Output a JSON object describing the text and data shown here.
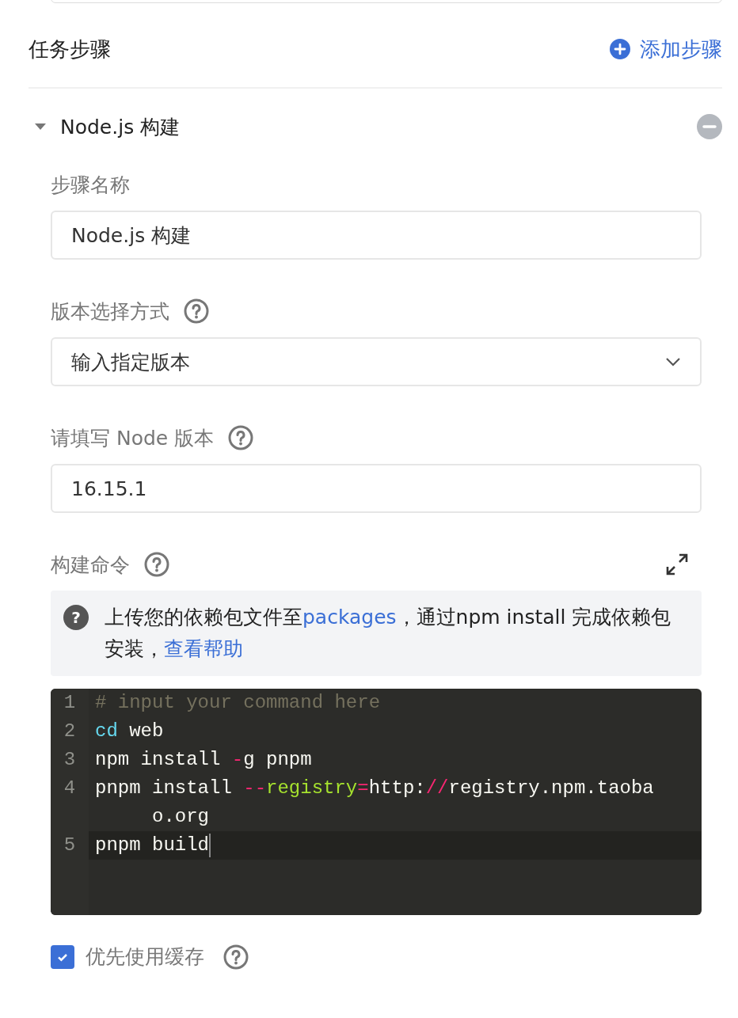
{
  "section": {
    "title": "任务步骤",
    "add_button": "添加步骤"
  },
  "step": {
    "title": "Node.js 构建",
    "expanded": true,
    "fields": [
      {
        "kind": "text",
        "label": "步骤名称",
        "help": false,
        "value": "Node.js 构建"
      },
      {
        "kind": "select",
        "label": "版本选择方式",
        "help": true,
        "value": "输入指定版本"
      },
      {
        "kind": "text",
        "label": "请填写 Node 版本",
        "help": true,
        "value": "16.15.1"
      }
    ],
    "command": {
      "label": "构建命令",
      "help": true,
      "notice": {
        "icon": "?",
        "parts": [
          {
            "kind": "text",
            "text": "上传您的依赖包文件至"
          },
          {
            "kind": "link",
            "text": "packages"
          },
          {
            "kind": "text",
            "text": "，通过npm install 完成依赖包安装，"
          },
          {
            "kind": "link",
            "text": "查看帮助"
          }
        ]
      },
      "lines": [
        {
          "number": "1",
          "active": false,
          "tokens": [
            {
              "kind": "comment",
              "text": "# input your command here"
            }
          ]
        },
        {
          "number": "2",
          "active": false,
          "tokens": [
            {
              "kind": "keyword",
              "text": "cd"
            },
            {
              "kind": "plain",
              "text": " web"
            }
          ]
        },
        {
          "number": "3",
          "active": false,
          "tokens": [
            {
              "kind": "plain",
              "text": "npm install "
            },
            {
              "kind": "operator",
              "text": "-"
            },
            {
              "kind": "plain",
              "text": "g pnpm"
            }
          ]
        },
        {
          "number": "4",
          "active": false,
          "tokens": [
            {
              "kind": "plain",
              "text": "pnpm install "
            },
            {
              "kind": "operator",
              "text": "--"
            },
            {
              "kind": "attribute",
              "text": "registry"
            },
            {
              "kind": "operator",
              "text": "="
            },
            {
              "kind": "plain",
              "text": "http:"
            },
            {
              "kind": "operator",
              "text": "//"
            },
            {
              "kind": "plain",
              "text": "registry.npm.taobao.org"
            }
          ]
        },
        {
          "number": "5",
          "active": true,
          "tokens": [
            {
              "kind": "plain",
              "text": "pnpm build"
            }
          ]
        }
      ]
    },
    "cache": {
      "label": "优先使用缓存",
      "checked": true,
      "help": true
    }
  }
}
